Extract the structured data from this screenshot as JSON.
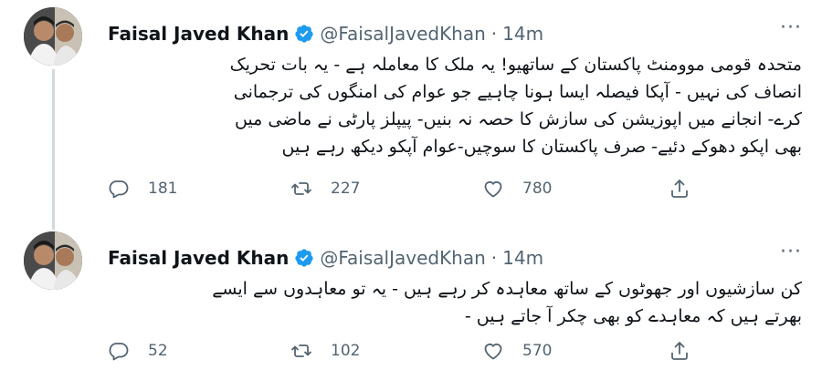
{
  "tweets": [
    {
      "author": "Faisal Javed Khan",
      "handle": "@FaisalJavedKhan",
      "separator": "·",
      "time": "14m",
      "lines": [
        "متحدہ قومی موومنٹ پاکستان کے ساتھیو! یہ ملک کا معاملہ ہے - یہ بات تحریک",
        "انصاف کی نہیں - آپکا فیصلہ ایسا ہونا چاہیے جو عوام کی امنگوں کی ترجمانی",
        "کرے- انجانے میں اپوزیشن کی سازش کا حصہ نہ بنیں- پیپلز پارٹی نے ماضی میں",
        "بھی اپکو دھوکے دئیے- صرف پاکستان کا سوچیں-عوام آپکو دیکھ رہے ہیں"
      ],
      "replies": "181",
      "retweets": "227",
      "likes": "780"
    },
    {
      "author": "Faisal Javed Khan",
      "handle": "@FaisalJavedKhan",
      "separator": "·",
      "time": "14m",
      "lines": [
        "کن سازشیوں اور جھوٹوں کے ساتھ معاہدہ کر رہے ہیں - یہ تو معاہدوں سے ایسے",
        "بھرتے ہیں کہ معاہدے کو بھی چکر آ جاتے ہیں -"
      ],
      "replies": "52",
      "retweets": "102",
      "likes": "570"
    }
  ],
  "icons": {
    "verified": "verified-badge-icon",
    "more": "more-options-icon",
    "reply": "reply-icon",
    "retweet": "retweet-icon",
    "like": "like-icon",
    "share": "share-icon"
  },
  "colors": {
    "verified": "#1d9bf0",
    "muted": "#536471",
    "text": "#0f1419",
    "thread_line": "#cfd9de"
  }
}
